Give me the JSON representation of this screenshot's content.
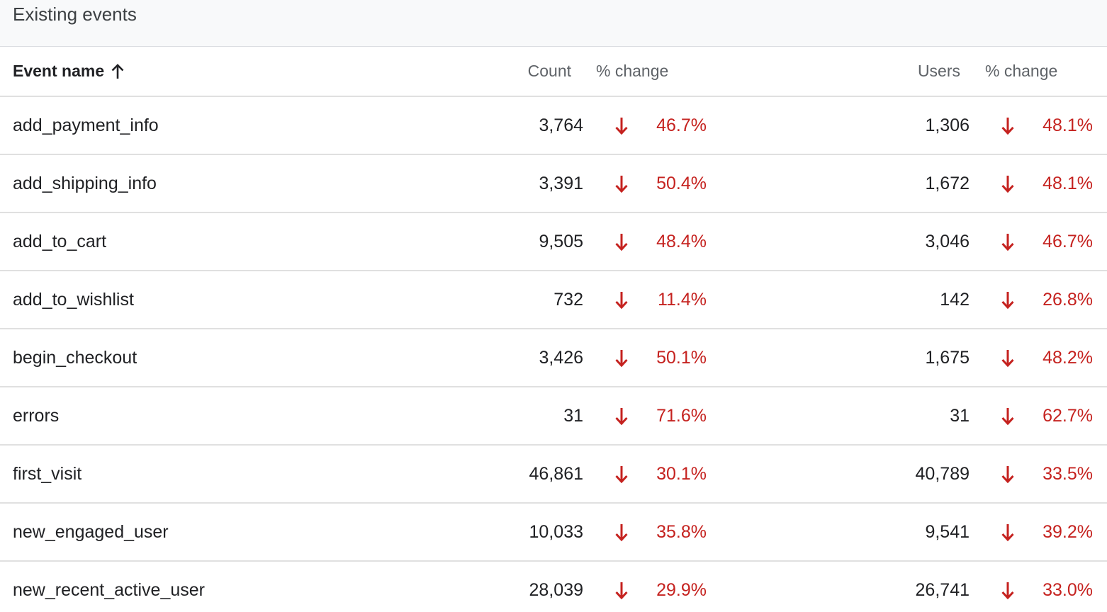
{
  "panel": {
    "title": "Existing events"
  },
  "columns": {
    "event_name": "Event name",
    "count": "Count",
    "count_change": "% change",
    "users": "Users",
    "users_change": "% change",
    "sort_direction": "ascending"
  },
  "colors": {
    "negative": "#c5221f",
    "header_bg": "#f8f9fa",
    "divider": "#e0e0e0"
  },
  "rows": [
    {
      "name": "add_payment_info",
      "count": "3,764",
      "count_change": "46.7%",
      "count_trend": "down",
      "users": "1,306",
      "users_change": "48.1%",
      "users_trend": "down"
    },
    {
      "name": "add_shipping_info",
      "count": "3,391",
      "count_change": "50.4%",
      "count_trend": "down",
      "users": "1,672",
      "users_change": "48.1%",
      "users_trend": "down"
    },
    {
      "name": "add_to_cart",
      "count": "9,505",
      "count_change": "48.4%",
      "count_trend": "down",
      "users": "3,046",
      "users_change": "46.7%",
      "users_trend": "down"
    },
    {
      "name": "add_to_wishlist",
      "count": "732",
      "count_change": "11.4%",
      "count_trend": "down",
      "users": "142",
      "users_change": "26.8%",
      "users_trend": "down"
    },
    {
      "name": "begin_checkout",
      "count": "3,426",
      "count_change": "50.1%",
      "count_trend": "down",
      "users": "1,675",
      "users_change": "48.2%",
      "users_trend": "down"
    },
    {
      "name": "errors",
      "count": "31",
      "count_change": "71.6%",
      "count_trend": "down",
      "users": "31",
      "users_change": "62.7%",
      "users_trend": "down"
    },
    {
      "name": "first_visit",
      "count": "46,861",
      "count_change": "30.1%",
      "count_trend": "down",
      "users": "40,789",
      "users_change": "33.5%",
      "users_trend": "down"
    },
    {
      "name": "new_engaged_user",
      "count": "10,033",
      "count_change": "35.8%",
      "count_trend": "down",
      "users": "9,541",
      "users_change": "39.2%",
      "users_trend": "down"
    },
    {
      "name": "new_recent_active_user",
      "count": "28,039",
      "count_change": "29.9%",
      "count_trend": "down",
      "users": "26,741",
      "users_change": "33.0%",
      "users_trend": "down"
    }
  ]
}
